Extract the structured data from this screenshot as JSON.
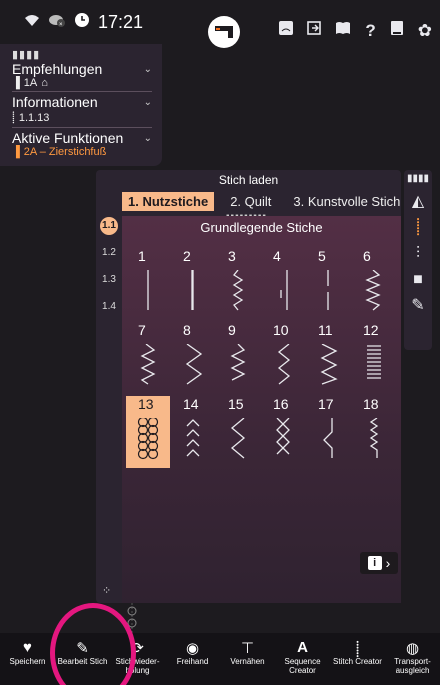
{
  "status": {
    "time": "17:21"
  },
  "info_panel": {
    "sections": [
      {
        "title": "Empfehlungen",
        "sub": "1A"
      },
      {
        "title": "Informationen",
        "sub": "1.1.13"
      },
      {
        "title": "Aktive Funktionen",
        "sub": "2A – Zierstichfuß"
      }
    ]
  },
  "dialog": {
    "title": "Stich laden",
    "tabs": [
      "1. Nutzstiche",
      "2. Quilt",
      "3. Kunstvolle Stich"
    ],
    "category_title": "Grundlegende Stiche",
    "side_numbers": [
      "1.1",
      "1.2",
      "1.3",
      "1.4"
    ],
    "stitches": [
      "1",
      "2",
      "3",
      "4",
      "5",
      "6",
      "7",
      "8",
      "9",
      "10",
      "11",
      "12",
      "13",
      "14",
      "15",
      "16",
      "17",
      "18"
    ],
    "selected": "13"
  },
  "bottom_toolbar": [
    {
      "label": "Speichern",
      "icon": "heart-icon"
    },
    {
      "label": "Bearbeit Stich",
      "icon": "edit-stitch-icon"
    },
    {
      "label": "Stichwieder-holung",
      "icon": "repeat-icon"
    },
    {
      "label": "Freihand",
      "icon": "freehand-icon"
    },
    {
      "label": "Vernähen",
      "icon": "tie-off-icon"
    },
    {
      "label": "Sequence Creator",
      "icon": "sequence-icon"
    },
    {
      "label": "Stitch Creator",
      "icon": "stitch-creator-icon"
    },
    {
      "label": "Transport-ausgleich",
      "icon": "balance-icon"
    }
  ],
  "colors": {
    "accent": "#f8b98a",
    "active_text": "#ff9940",
    "highlight_ring": "#e4177f",
    "panel": "#2b2430"
  }
}
